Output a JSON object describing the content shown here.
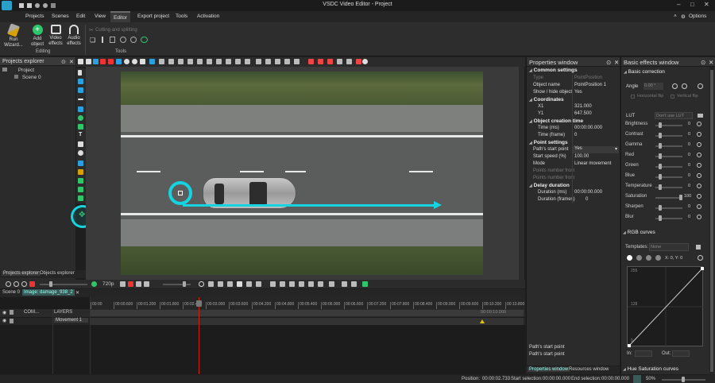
{
  "titlebar": {
    "title": "VSDC Video Editor - Project"
  },
  "menu": {
    "projects": "Projects",
    "scenes": "Scenes",
    "edit": "Edit",
    "view": "View",
    "editor": "Editor",
    "export": "Export project",
    "tools": "Tools",
    "activation": "Activation",
    "options": "Options"
  },
  "ribbon": {
    "run_wizard": "Run Wizard...",
    "add_object": "Add object",
    "video_effects": "Video effects",
    "audio_effects": "Audio effects",
    "editing_group": "Editing",
    "cutting": "Cutting and splitting",
    "tools_group": "Tools"
  },
  "projects_explorer": {
    "title": "Projects explorer",
    "project": "Project",
    "scene": "Scene 0",
    "tab_projects": "Projects explorer",
    "tab_objects": "Objects explorer"
  },
  "properties": {
    "title": "Properties window",
    "common_settings": "Common settings",
    "type_label": "Type",
    "type_value": "PointPosition",
    "object_name_label": "Object name",
    "object_name_value": "PointPosition 1",
    "show_hide_label": "Show / hide object",
    "show_hide_value": "Yes",
    "coordinates": "Coordinates",
    "x1_label": "X1",
    "x1_value": "321.000",
    "y1_label": "Y1",
    "y1_value": "647.500",
    "creation_time": "Object creation time",
    "time_ms_label": "Time (ms)",
    "time_ms_value": "00:00:00.000",
    "time_frame_label": "Time (frame)",
    "time_frame_value": "0",
    "point_settings": "Point settings",
    "start_point_label": "Path's start point",
    "start_point_value": "Yes",
    "start_speed_label": "Start speed (%)",
    "start_speed_value": "100.00",
    "mode_label": "Mode",
    "mode_value": "Linear movement",
    "points_from1": "Points number from",
    "points_from2": "Points number from",
    "delay_duration": "Delay duration",
    "duration_ms_label": "Duration (ms)",
    "duration_ms_value": "00:00:00.000",
    "duration_frames_label": "Duration (frames)",
    "duration_frames_value": "0",
    "help_title": "Path's start point",
    "help_text": "Path's start point",
    "tab_properties": "Properties window",
    "tab_resources": "Resources window"
  },
  "effects": {
    "title": "Basic effects window",
    "basic_correction": "Basic correction",
    "angle": "Angle",
    "angle_value": "0.00 °",
    "hflip": "Horizontal flip",
    "vflip": "Vertical flip",
    "lut": "LUT",
    "lut_value": "Don't use LUT",
    "brightness": "Brightness",
    "brightness_value": "0",
    "contrast": "Contrast",
    "contrast_value": "0",
    "gamma": "Gamma",
    "gamma_value": "0",
    "red": "Red",
    "red_value": "0",
    "green": "Green",
    "green_value": "0",
    "blue": "Blue",
    "blue_value": "0",
    "temperature": "Temperature",
    "temperature_value": "0",
    "saturation": "Saturation",
    "saturation_value": "100",
    "sharpen": "Sharpen",
    "sharpen_value": "0",
    "blur": "Blur",
    "blur_value": "0",
    "rgb_curves": "RGB curves",
    "templates": "Templates:",
    "templates_value": "None",
    "xy_readout": "X: 0, Y: 0",
    "curve_top": "255",
    "curve_mid": "128",
    "curve_bottom": "0",
    "in_label": "In:",
    "out_label": "Out:",
    "hue_sat": "Hue Saturation curves"
  },
  "timeline": {
    "resolution": "720p",
    "scene_tab": "Scene 0",
    "image_tab": "Image: damage_938_2",
    "com_label": "COM...",
    "layers_label": "LAYERS",
    "movement_label": "Movement 1",
    "time_marker": "00:00:10.000",
    "ticks": [
      "00:00",
      "00:00.600",
      "00:01.200",
      "00:01.800",
      "00:02.400",
      "00:03.000",
      "00:03.600",
      "00:04.200",
      "00:04.800",
      "00:05.400",
      "00:06.000",
      "00:06.600",
      "00:07.200",
      "00:07.800",
      "00:08.400",
      "00:09.000",
      "00:09.600",
      "00:10.200",
      "00:10.800"
    ]
  },
  "statusbar": {
    "position_label": "Position:",
    "position_value": "00:00:02.733",
    "start_label": "Start selection:",
    "start_value": "00:00:00.000",
    "end_label": "End selection:",
    "end_value": "00:00:00.000",
    "zoom": "50%"
  }
}
